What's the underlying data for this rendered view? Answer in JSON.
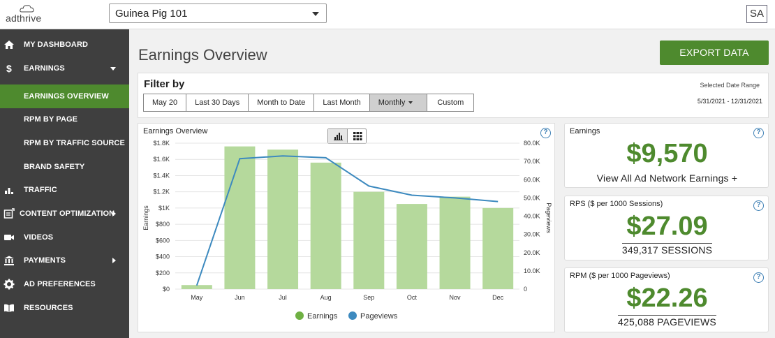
{
  "brand": {
    "logo_text": "adthrive",
    "accent": "#4e8a2e"
  },
  "header": {
    "site_selected": "Guinea Pig 101",
    "avatar_initials": "SA"
  },
  "sidebar": {
    "items": [
      {
        "label": "MY DASHBOARD",
        "icon": "home-icon"
      },
      {
        "label": "EARNINGS",
        "icon": "dollar-icon"
      },
      {
        "label": "EARNINGS OVERVIEW",
        "icon": ""
      },
      {
        "label": "RPM BY PAGE",
        "icon": ""
      },
      {
        "label": "RPM BY TRAFFIC SOURCE",
        "icon": ""
      },
      {
        "label": "BRAND SAFETY",
        "icon": ""
      },
      {
        "label": "TRAFFIC",
        "icon": "bar-chart-icon"
      },
      {
        "label": "CONTENT OPTIMIZATION",
        "icon": "content-optimization-icon"
      },
      {
        "label": "VIDEOS",
        "icon": "video-camera-icon"
      },
      {
        "label": "PAYMENTS",
        "icon": "bank-icon"
      },
      {
        "label": "AD PREFERENCES",
        "icon": "gear-icon"
      },
      {
        "label": "RESOURCES",
        "icon": "book-icon"
      }
    ]
  },
  "main": {
    "title": "Earnings Overview",
    "export_label": "EXPORT DATA",
    "filter": {
      "title": "Filter by",
      "buttons": [
        "May 20",
        "Last 30 Days",
        "Month to Date",
        "Last Month",
        "Monthly",
        "Custom"
      ],
      "selected": "Monthly",
      "date_label": "Selected Date Range",
      "date_range": "5/31/2021 - 12/31/2021"
    }
  },
  "metrics": [
    {
      "title": "Earnings",
      "value": "$9,570",
      "sub": "View All Ad Network Earnings +"
    },
    {
      "title": "RPS ($ per 1000 Sessions)",
      "value": "$27.09",
      "sub": "349,317 SESSIONS"
    },
    {
      "title": "RPM ($ per 1000 Pageviews)",
      "value": "$22.26",
      "sub": "425,088 PAGEVIEWS"
    }
  ],
  "chart_data": {
    "type": "bar",
    "title": "Earnings Overview",
    "categories": [
      "May",
      "Jun",
      "Jul",
      "Aug",
      "Sep",
      "Oct",
      "Nov",
      "Dec"
    ],
    "series": [
      {
        "name": "Earnings",
        "type": "bar",
        "axis": "left",
        "color": "#b5d99c",
        "values": [
          50,
          1760,
          1720,
          1560,
          1200,
          1050,
          1140,
          1000
        ]
      },
      {
        "name": "Pageviews",
        "type": "line",
        "axis": "right",
        "color": "#3d8abf",
        "values": [
          2000,
          71500,
          73000,
          72000,
          56500,
          51500,
          50000,
          48000
        ]
      }
    ],
    "ylabel": "Earnings",
    "y2label": "Pageviews",
    "ylim": [
      0,
      1800
    ],
    "y2lim": [
      0,
      80000
    ],
    "yticks": [
      "$0",
      "$200",
      "$400",
      "$600",
      "$800",
      "$1K",
      "$1.2K",
      "$1.4K",
      "$1.6K",
      "$1.8K"
    ],
    "y2ticks": [
      "0",
      "10.0K",
      "20.0K",
      "30.0K",
      "40.0K",
      "50.0K",
      "60.0K",
      "70.0K",
      "80.0K"
    ],
    "legend_position": "bottom",
    "grid": true
  }
}
